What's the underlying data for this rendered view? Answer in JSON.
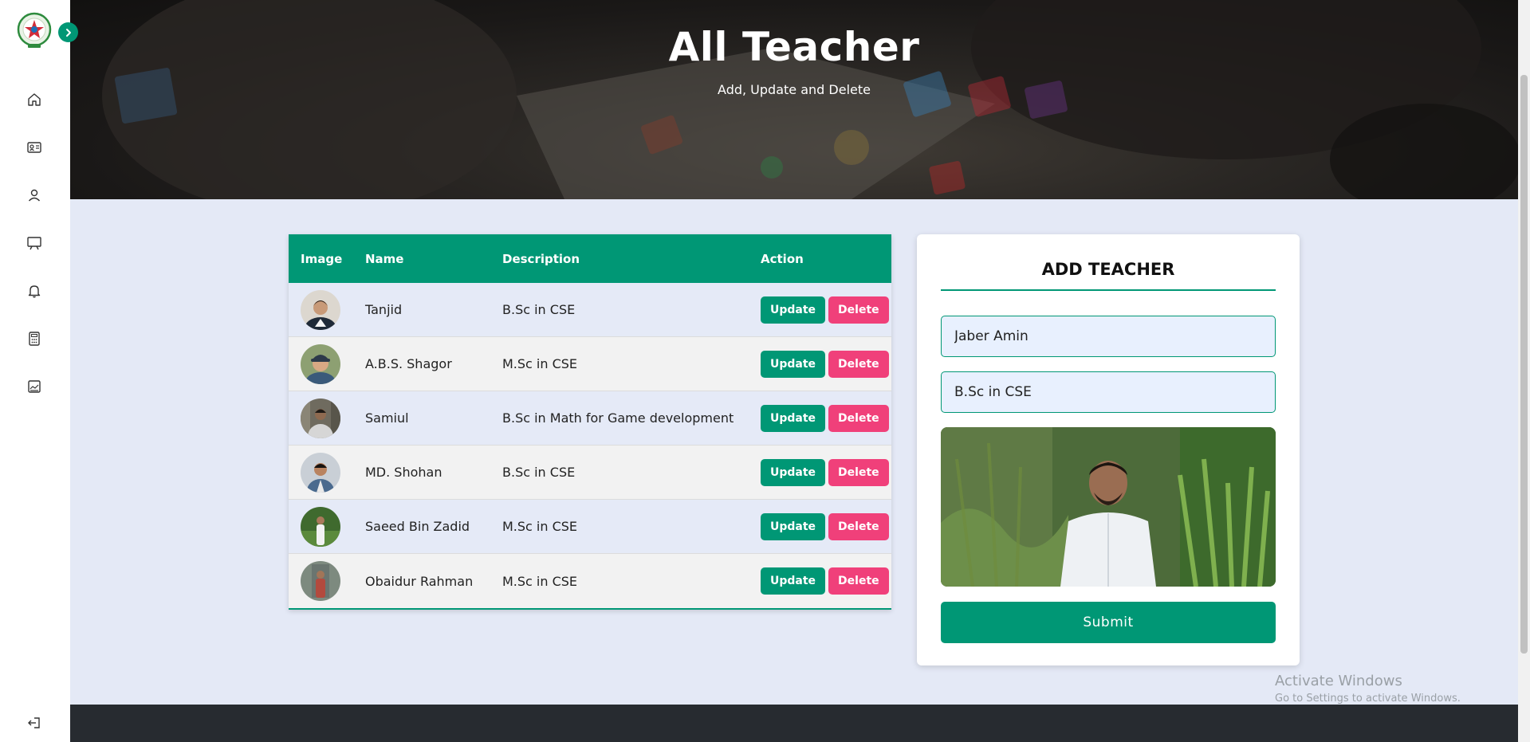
{
  "sidebar": {
    "items": [
      {
        "icon": "home-icon"
      },
      {
        "icon": "id-card-icon"
      },
      {
        "icon": "user-icon"
      },
      {
        "icon": "presentation-board-icon"
      },
      {
        "icon": "bell-icon"
      },
      {
        "icon": "calculator-icon"
      },
      {
        "icon": "image-icon"
      }
    ],
    "logout_icon": "logout-icon"
  },
  "hero": {
    "title": "All Teacher",
    "subtitle": "Add, Update and Delete"
  },
  "table": {
    "headers": {
      "image": "Image",
      "name": "Name",
      "description": "Description",
      "action": "Action"
    },
    "rows": [
      {
        "name": "Tanjid",
        "description": "B.Sc in CSE",
        "update": "Update",
        "delete": "Delete"
      },
      {
        "name": "A.B.S. Shagor",
        "description": "M.Sc in CSE",
        "update": "Update",
        "delete": "Delete"
      },
      {
        "name": "Samiul",
        "description": "B.Sc in Math for Game development",
        "update": "Update",
        "delete": "Delete"
      },
      {
        "name": "MD. Shohan",
        "description": "B.Sc in CSE",
        "update": "Update",
        "delete": "Delete"
      },
      {
        "name": "Saeed Bin Zadid",
        "description": "M.Sc in CSE",
        "update": "Update",
        "delete": "Delete"
      },
      {
        "name": "Obaidur Rahman",
        "description": "M.Sc in CSE",
        "update": "Update",
        "delete": "Delete"
      }
    ]
  },
  "form": {
    "title": "ADD TEACHER",
    "name_value": "Jaber Amin",
    "description_value": "B.Sc in CSE",
    "submit_label": "Submit"
  },
  "watermark": {
    "line1": "Activate Windows",
    "line2": "Go to Settings to activate Windows."
  },
  "colors": {
    "primary": "#009775",
    "danger": "#f0407a",
    "page_bg": "#e4e9f6",
    "footer_bg": "#272b30"
  }
}
